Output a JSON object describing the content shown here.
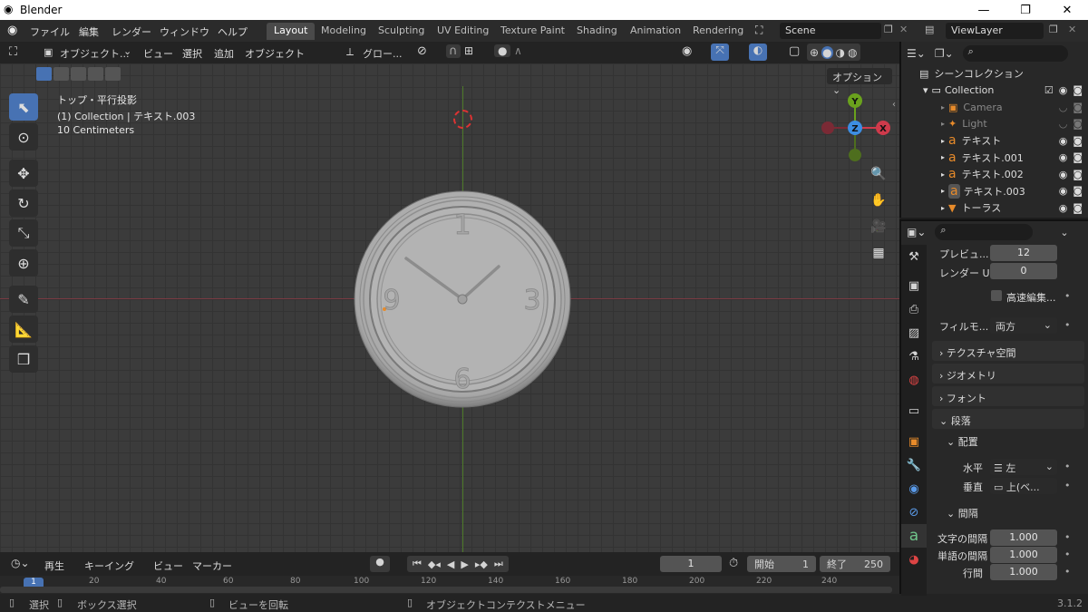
{
  "window": {
    "app_title": "Blender",
    "minimize": "—",
    "maximize": "❐",
    "close": "✕"
  },
  "topbar": {
    "menus": [
      "ファイル",
      "編集",
      "レンダー",
      "ウィンドウ",
      "ヘルプ"
    ],
    "workspaces": [
      "Layout",
      "Modeling",
      "Sculpting",
      "UV Editing",
      "Texture Paint",
      "Shading",
      "Animation",
      "Rendering"
    ],
    "active_workspace": "Layout",
    "scene": "Scene",
    "viewlayer": "ViewLayer"
  },
  "viewport_header": {
    "mode": "オブジェクト...",
    "menus": [
      "ビュー",
      "選択",
      "追加",
      "オブジェクト"
    ],
    "transform_orientation": "グロー...",
    "options": "オプション"
  },
  "viewport": {
    "overlay_lines": [
      "トップ・平行投影",
      "(1) Collection | テキスト.003",
      "10 Centimeters"
    ],
    "gizmo": {
      "y": "Y",
      "z": "Z",
      "x": "X"
    },
    "clock_numbers": [
      "1",
      "3",
      "6",
      "9"
    ]
  },
  "colors": {
    "accent": "#4772b3",
    "x_axis": "#cf3a4b",
    "y_axis": "#6aa21d",
    "z_axis": "#3d8ee3",
    "text_orange": "#e88b2a"
  },
  "outliner": {
    "title": "シーンコレクション",
    "items": [
      {
        "label": "Collection",
        "icon": "collection-icon",
        "depth": 1
      },
      {
        "label": "Camera",
        "icon": "camera-icon",
        "depth": 2,
        "dim": true
      },
      {
        "label": "Light",
        "icon": "light-icon",
        "depth": 2,
        "dim": true
      },
      {
        "label": "テキスト",
        "icon": "text-object-icon",
        "depth": 2
      },
      {
        "label": "テキスト.001",
        "icon": "text-object-icon",
        "depth": 2
      },
      {
        "label": "テキスト.002",
        "icon": "text-object-icon",
        "depth": 2
      },
      {
        "label": "テキスト.003",
        "icon": "text-object-icon",
        "depth": 2,
        "selected": true
      },
      {
        "label": "トーラス",
        "icon": "mesh-icon",
        "depth": 2
      }
    ]
  },
  "properties": {
    "preview_label": "プレビュ...",
    "preview_value": "12",
    "render_u_label": "レンダー U",
    "render_u_value": "0",
    "fast_edit": "高速編集...",
    "fill_mode_label": "フィルモ...",
    "fill_mode_value": "両方",
    "sections": [
      "テクスチャ空間",
      "ジオメトリ",
      "フォント",
      "段落"
    ],
    "align_section": "配置",
    "horizontal_label": "水平",
    "horizontal_value": "左",
    "vertical_label": "垂直",
    "vertical_value": "上(ベ...",
    "spacing_section": "間隔",
    "char_spacing_label": "文字の間隔",
    "char_spacing_value": "1.000",
    "word_spacing_label": "単語の間隔",
    "word_spacing_value": "1.000",
    "line_spacing_label": "行間",
    "line_spacing_value": "1.000"
  },
  "timeline": {
    "menus": [
      "再生",
      "キーイング",
      "ビュー",
      "マーカー"
    ],
    "current_frame": "1",
    "start_label": "開始",
    "start_value": "1",
    "end_label": "終了",
    "end_value": "250",
    "ticks": [
      "1",
      "20",
      "40",
      "60",
      "80",
      "100",
      "120",
      "140",
      "160",
      "180",
      "200",
      "220",
      "240"
    ]
  },
  "statusbar": {
    "select": "選択",
    "box_select": "ボックス選択",
    "rotate_view": "ビューを回転",
    "context_menu": "オブジェクトコンテクストメニュー",
    "version": "3.1.2"
  }
}
